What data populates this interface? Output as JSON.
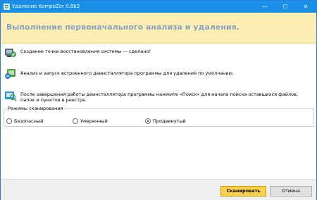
{
  "window": {
    "title": "Удаление KompoZer 0.8b3",
    "minimize_glyph": "—",
    "maximize_glyph": "☐",
    "close_glyph": "✕"
  },
  "banner": {
    "title": "Выполнение первоначального анализа и удаления."
  },
  "steps": [
    {
      "icon": "restore-point-check-icon",
      "text": "Создание точки восстановления системы — сделано!"
    },
    {
      "icon": "uninstaller-run-icon",
      "text": "Анализ и запуск встроенного деинсталлятора программы для удаления по умолчанию."
    },
    {
      "icon": "search-leftovers-icon",
      "text": "После завершения работы деинсталлятора программы нажмите «Поиск» для начала поиска оставшихся файлов, папок и пунктов в реестре."
    }
  ],
  "scan_modes": {
    "legend": "Режимы сканирования",
    "options": [
      "Безопасный",
      "Умеренный",
      "Продвинутый"
    ],
    "selected": "Продвинутый"
  },
  "footer": {
    "scan_label": "Сканировать",
    "cancel_label": "Отмена"
  },
  "colors": {
    "titlebar": "#1a8fe6",
    "banner_bg": "#fdefb3",
    "banner_text": "#8aa4be",
    "primary_button": "#ffd04c"
  }
}
